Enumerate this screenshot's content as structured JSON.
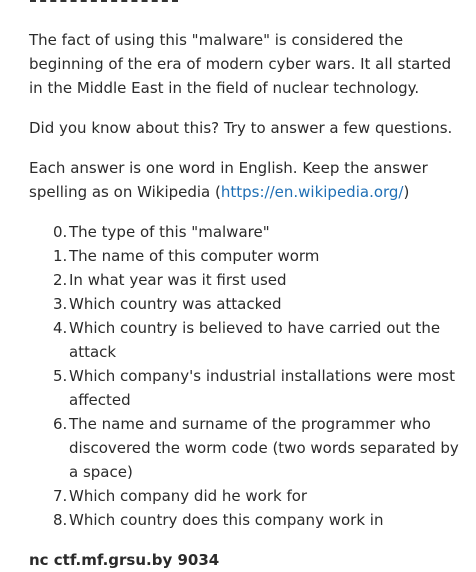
{
  "intro": "The fact of using this \"malware\" is considered the beginning of the era of modern cyber wars. It all started in the Middle East in the field of nuclear technology.",
  "question": "Did you know about this? Try to answer a few questions.",
  "instruction": {
    "text": "Each answer is one word in English. Keep the answer spelling as on Wikipedia (",
    "link": "https://en.wikipedia.org/",
    "suffix": ")"
  },
  "questions": [
    {
      "num": "0.",
      "text": "The type of this \"malware\""
    },
    {
      "num": "1.",
      "text": "The name of this computer worm"
    },
    {
      "num": "2.",
      "text": "In what year was it first used"
    },
    {
      "num": "3.",
      "text": "Which country was attacked"
    },
    {
      "num": "4.",
      "text": "Which country is believed to have carried out the attack"
    },
    {
      "num": "5.",
      "text": "Which company's industrial installations were most affected"
    },
    {
      "num": "6.",
      "text": "The name and surname of the programmer who discovered the worm code (two words separated by a space)"
    },
    {
      "num": "7.",
      "text": "Which company did he work for"
    },
    {
      "num": "8.",
      "text": "Which country does this company work in"
    }
  ],
  "command": "nc ctf.mf.grsu.by 9034"
}
